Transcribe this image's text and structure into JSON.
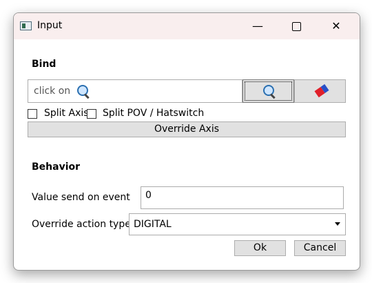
{
  "window": {
    "title": "Input",
    "app_icon": "app-window-icon",
    "controls": {
      "minimize": "—",
      "maximize": "maximize-icon",
      "close": "✕"
    }
  },
  "bind": {
    "section_label": "Bind",
    "field_text": "click on",
    "field_icon": "magnifier-icon",
    "search_button_icon": "magnifier-icon",
    "erase_button_icon": "eraser-icon",
    "split_axis_label": "Split Axis",
    "split_axis_checked": false,
    "split_pov_label": "Split POV / Hatswitch",
    "split_pov_checked": false,
    "override_axis_label": "Override Axis"
  },
  "behavior": {
    "section_label": "Behavior",
    "value_label": "Value send on event",
    "value": "0",
    "override_type_label": "Override action type",
    "override_type_selected": "DIGITAL"
  },
  "buttons": {
    "ok": "Ok",
    "cancel": "Cancel"
  },
  "colors": {
    "titlebar": "#f9eeee",
    "button_bg": "#e1e1e1",
    "border": "#acacac"
  }
}
